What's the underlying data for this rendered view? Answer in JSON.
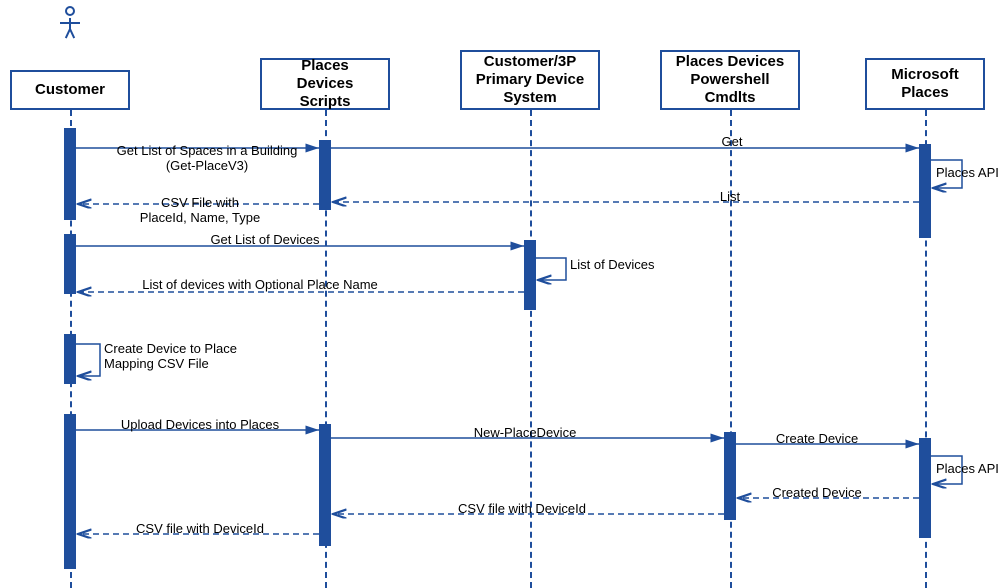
{
  "participants": {
    "customer": "Customer",
    "scripts": "Places Devices\nScripts",
    "primary": "Customer/3P\nPrimary\nDevice System",
    "cmdlets": "Places Devices\nPowershell\nCmdlts",
    "places": "Microsoft\nPlaces"
  },
  "messages": {
    "m1": "Get List of Spaces in a Building\n(Get-PlaceV3)",
    "m2": "Get",
    "m3": "Places API",
    "m4": "List",
    "m5": "CSV File with\nPlaceId, Name, Type",
    "m6": "Get List of Devices",
    "m7": "List of Devices",
    "m8": "List of devices with Optional Place Name",
    "m9": "Create Device to Place\nMapping CSV File",
    "m10": "Upload Devices into Places",
    "m11": "New-PlaceDevice",
    "m12": "Create Device",
    "m13": "Places API",
    "m14": "Created Device",
    "m15": "CSV file with DeviceId",
    "m16": "CSV file with DeviceId"
  }
}
